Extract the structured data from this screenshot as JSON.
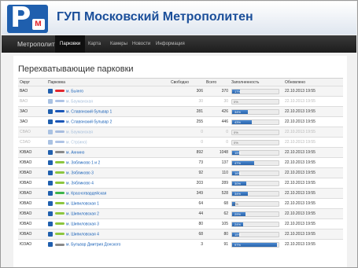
{
  "header": {
    "title": "ГУП Московский Метрополитен",
    "logo_letter": "P"
  },
  "nav": {
    "brand": "Метрополитен",
    "items": [
      {
        "label": "Парковки",
        "active": true
      },
      {
        "label": "Карта",
        "active": false
      },
      {
        "label": "Камеры",
        "active": false
      },
      {
        "label": "Новости",
        "active": false
      },
      {
        "label": "Информация",
        "active": false
      }
    ]
  },
  "page": {
    "title": "Перехватывающие парковки"
  },
  "table": {
    "columns": [
      "Округ",
      "Парковка",
      "Свободно",
      "Всего",
      "Заполненность",
      "Обновлено"
    ],
    "rows": [
      {
        "district": "ВАО",
        "name": "м. Бьянго",
        "free": "306",
        "total": "370",
        "fill": 17,
        "fill_label": "17%",
        "updated": "22.10.2013 19:55",
        "dim": false,
        "line_color": "#e3252c"
      },
      {
        "district": "ВАО",
        "name": "м. Бауманская",
        "free": "30",
        "total": "30",
        "fill": 0,
        "fill_label": "0%",
        "updated": "22.10.2013 19:55",
        "dim": true,
        "line_color": "#1a56b8"
      },
      {
        "district": "ЗАО",
        "name": "м. Славянский бульвар 1",
        "free": "281",
        "total": "426",
        "fill": 34,
        "fill_label": "34%",
        "updated": "22.10.2013 19:55",
        "dim": false,
        "line_color": "#1a56b8"
      },
      {
        "district": "ЗАО",
        "name": "м. Славянский бульвар 2",
        "free": "255",
        "total": "446",
        "fill": 43,
        "fill_label": "43%",
        "updated": "22.10.2013 19:55",
        "dim": false,
        "line_color": "#1a56b8"
      },
      {
        "district": "СВАО",
        "name": "м. Бауманская",
        "free": "0",
        "total": "0",
        "fill": 0,
        "fill_label": "0%",
        "updated": "22.10.2013 19:55",
        "dim": true,
        "line_color": "#1a56b8"
      },
      {
        "district": "СЗАО",
        "name": "м. Стр(ино)",
        "free": "0",
        "total": "0",
        "fill": 0,
        "fill_label": "0%",
        "updated": "22.10.2013 19:55",
        "dim": true,
        "line_color": "#1a56b8"
      },
      {
        "district": "ЮВАО",
        "name": "м. Аннино",
        "free": "892",
        "total": "1048",
        "fill": 15,
        "fill_label": "15%",
        "updated": "22.10.2013 19:55",
        "dim": false,
        "line_color": "#8a8a8a"
      },
      {
        "district": "ЮВАО",
        "name": "м. Зябликово 1 и 2",
        "free": "73",
        "total": "137",
        "fill": 47,
        "fill_label": "47%",
        "updated": "22.10.2013 19:55",
        "dim": false,
        "line_color": "#8cc63f"
      },
      {
        "district": "ЮВАО",
        "name": "м. Зябликово 3",
        "free": "92",
        "total": "110",
        "fill": 16,
        "fill_label": "16%",
        "updated": "22.10.2013 19:55",
        "dim": false,
        "line_color": "#8cc63f"
      },
      {
        "district": "ЮВАО",
        "name": "м. Зябликово 4",
        "free": "203",
        "total": "289",
        "fill": 30,
        "fill_label": "30%",
        "updated": "22.10.2013 19:55",
        "dim": false,
        "line_color": "#8cc63f"
      },
      {
        "district": "ЮВАО",
        "name": "м. Красногвардейская",
        "free": "349",
        "total": "528",
        "fill": 34,
        "fill_label": "34%",
        "updated": "22.10.2013 19:55",
        "dim": false,
        "line_color": "#3cb54a"
      },
      {
        "district": "ЮВАО",
        "name": "м. Шипиловская 1",
        "free": "64",
        "total": "68",
        "fill": 6,
        "fill_label": "6%",
        "updated": "22.10.2013 19:55",
        "dim": false,
        "line_color": "#8cc63f"
      },
      {
        "district": "ЮВАО",
        "name": "м. Шипиловская 2",
        "free": "44",
        "total": "62",
        "fill": 29,
        "fill_label": "29%",
        "updated": "22.10.2013 19:55",
        "dim": false,
        "line_color": "#8cc63f"
      },
      {
        "district": "ЮВАО",
        "name": "м. Шипиловская 3",
        "free": "80",
        "total": "105",
        "fill": 24,
        "fill_label": "24%",
        "updated": "22.10.2013 19:55",
        "dim": false,
        "line_color": "#8cc63f"
      },
      {
        "district": "ЮВАО",
        "name": "м. Шипиловская 4",
        "free": "68",
        "total": "80",
        "fill": 15,
        "fill_label": "15%",
        "updated": "22.10.2013 19:55",
        "dim": false,
        "line_color": "#8cc63f"
      },
      {
        "district": "ЮЗАО",
        "name": "м. Бульвар Дмитрия Донского",
        "free": "3",
        "total": "91",
        "fill": 97,
        "fill_label": "97%",
        "updated": "22.10.2013 19:55",
        "dim": false,
        "line_color": "#8a8a8a"
      }
    ]
  }
}
